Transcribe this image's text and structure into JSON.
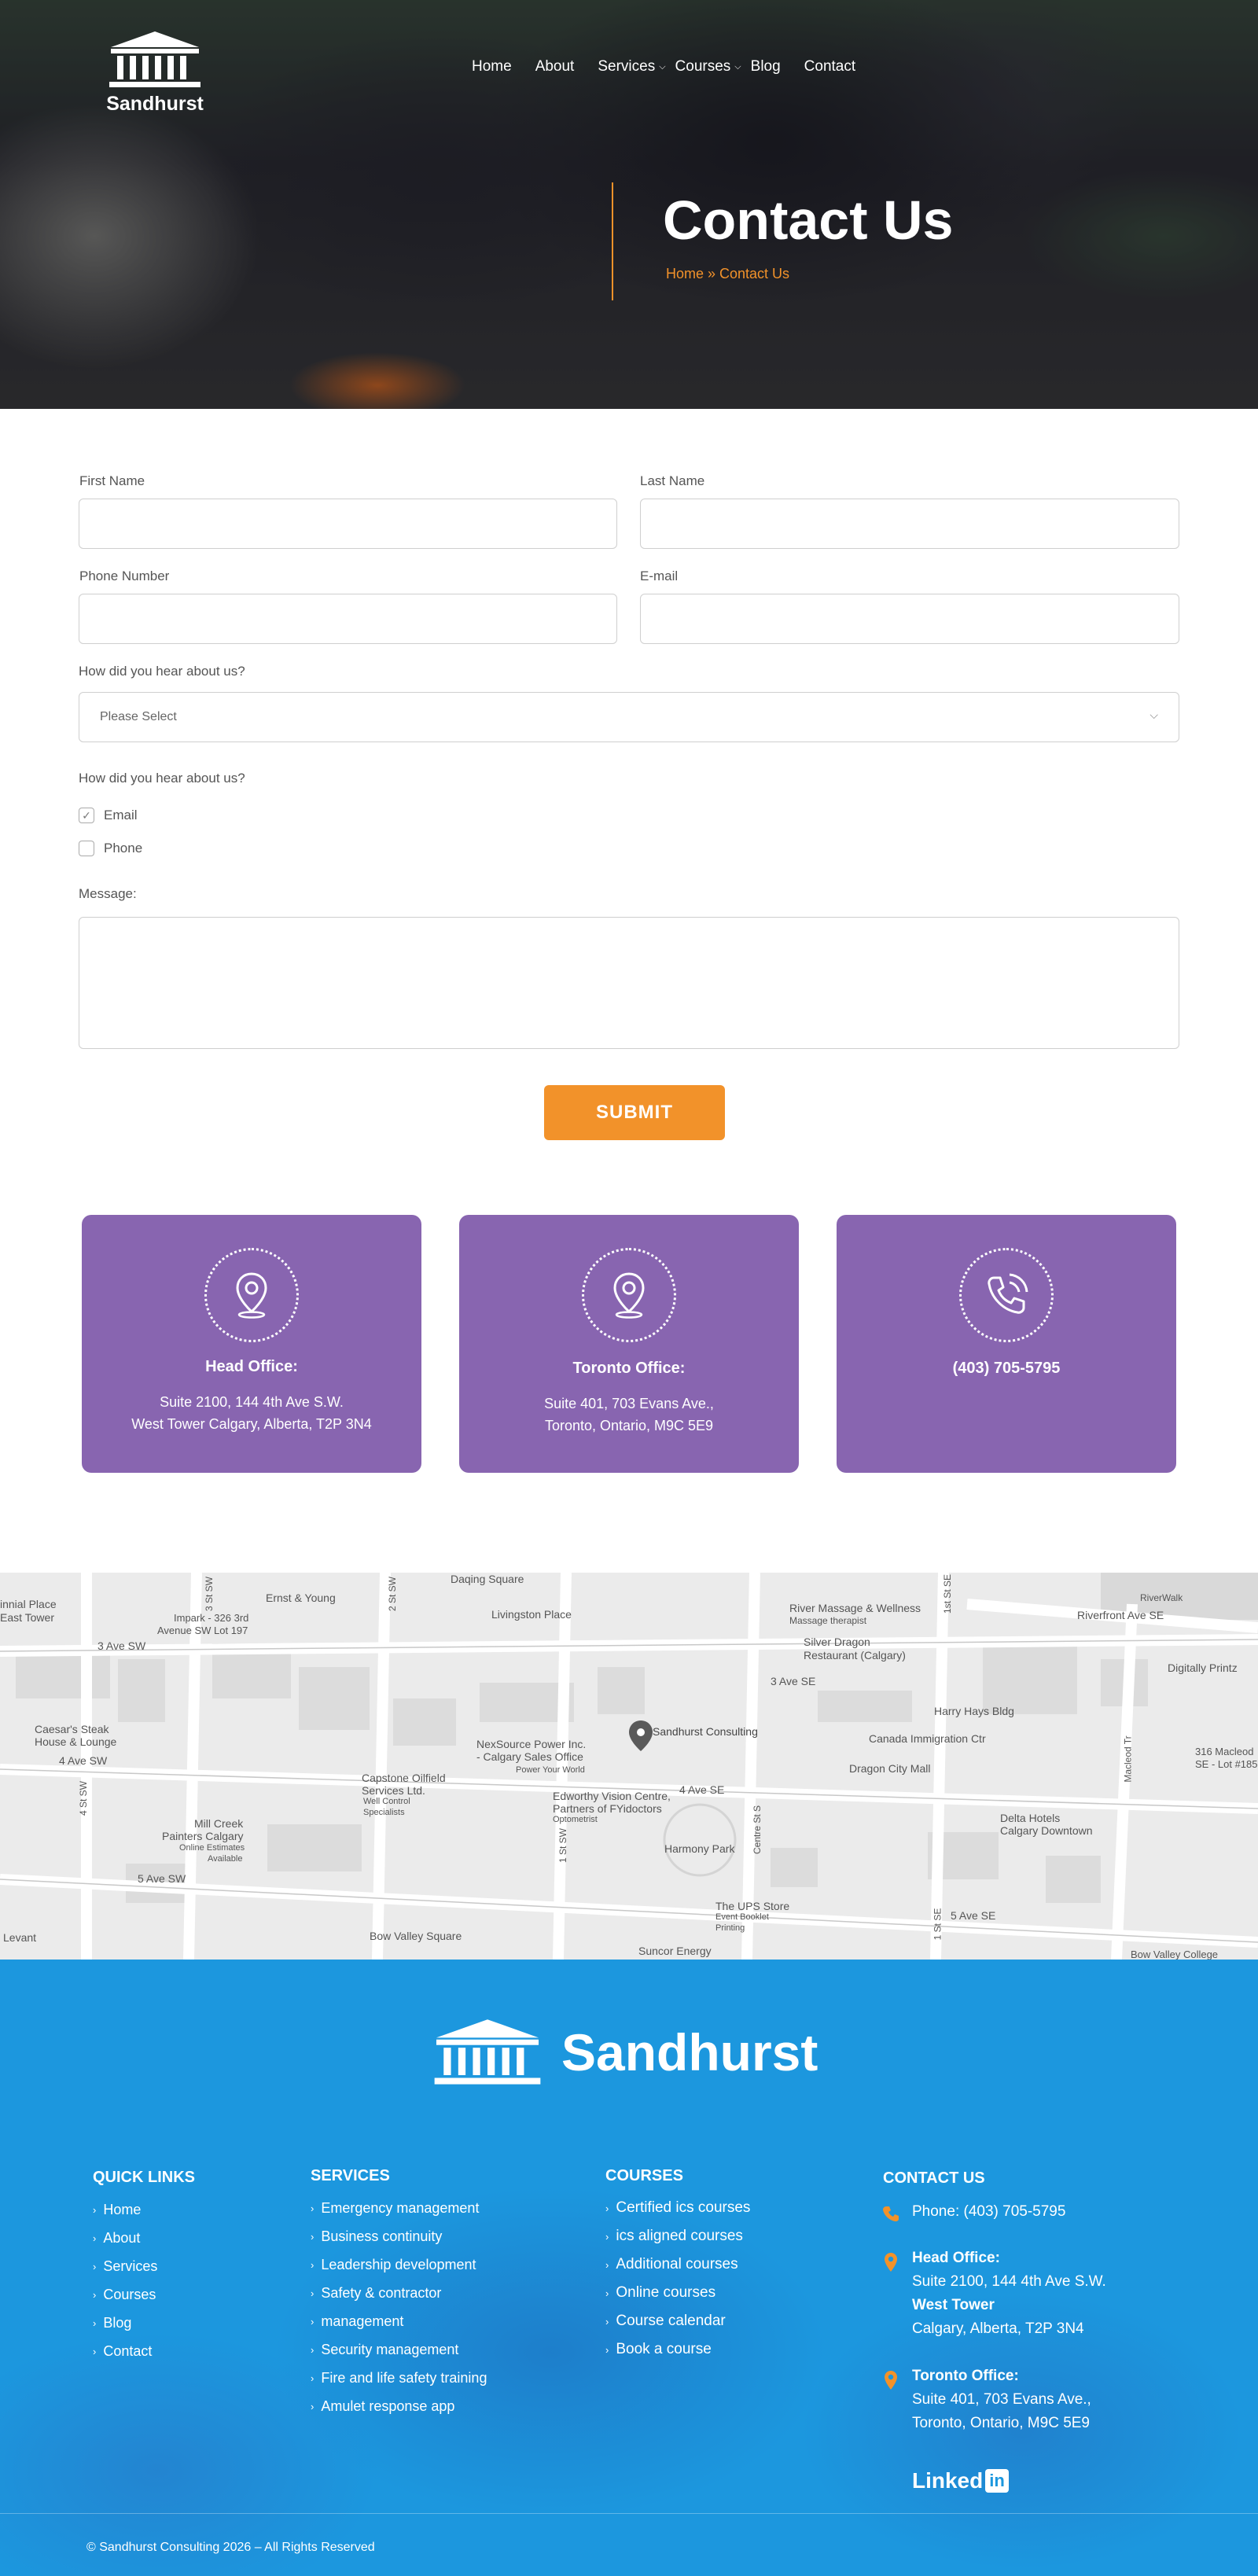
{
  "brand": {
    "name": "Sandhurst"
  },
  "nav": [
    {
      "label": "Home",
      "dropdown": false
    },
    {
      "label": "About",
      "dropdown": false
    },
    {
      "label": "Services",
      "dropdown": true
    },
    {
      "label": "Courses",
      "dropdown": true
    },
    {
      "label": "Blog",
      "dropdown": false
    },
    {
      "label": "Contact",
      "dropdown": false
    }
  ],
  "hero": {
    "title": "Contact Us",
    "breadcrumb": "Home » Contact Us"
  },
  "form": {
    "first_name_label": "First Name",
    "first_name_value": "",
    "last_name_label": "Last Name",
    "last_name_value": "",
    "phone_label": "Phone Number",
    "phone_value": "",
    "email_label": "E-mail",
    "email_value": "",
    "hear_label": "How did you hear about us?",
    "hear_selected": "Please Select",
    "contact_label": "How did you hear about us?",
    "options": [
      {
        "label": "Email",
        "checked": true
      },
      {
        "label": "Phone",
        "checked": false
      }
    ],
    "message_label": "Message:",
    "message_value": "",
    "submit_label": "SUBMIT"
  },
  "cards": [
    {
      "icon": "map-pin-icon",
      "title": "Head Office:",
      "lines": [
        "Suite 2100, 144 4th Ave S.W.",
        "West Tower Calgary, Alberta, T2P 3N4"
      ]
    },
    {
      "icon": "map-pin-icon",
      "title": "Toronto Office:",
      "lines": [
        "Suite 401, 703 Evans Ave.,",
        "Toronto, Ontario, M9C 5E9"
      ]
    },
    {
      "icon": "phone-icon",
      "title": "(403) 705-5795",
      "lines": []
    }
  ],
  "map": {
    "labels": [
      "Daqing Square",
      "Ernst & Young",
      "Livingston Place",
      "River Massage & Wellness",
      "Massage therapist",
      "Riverfront Ave SE",
      "RiverWalk",
      "Impark - 326 3rd",
      "Avenue SW Lot 197",
      "innial Place",
      "East Tower",
      "Silver Dragon",
      "Restaurant (Calgary)",
      "Digitally Printz",
      "3 Ave SW",
      "3 Ave SE",
      "Harry Hays Bldg",
      "Caesar's Steak",
      "House & Lounge",
      "Sandhurst Consulting",
      "Canada Immigration Ctr",
      "NexSource Power Inc.",
      "- Calgary Sales Office",
      "Power Your World",
      "Dragon City Mall",
      "316 Macleod",
      "SE - Lot #185",
      "4 Ave SW",
      "4 Ave SE",
      "Capstone Oilfield",
      "Services Ltd.",
      "Well Control",
      "Specialists",
      "Edworthy Vision Centre,",
      "Partners of FYidoctors",
      "Optometrist",
      "Delta Hotels",
      "Calgary Downtown",
      "Mill Creek",
      "Painters Calgary",
      "Online Estimates",
      "Available",
      "Harmony Park",
      "5 Ave SW",
      "5 Ave SE",
      "The UPS Store",
      "Event Booklet",
      "Printing",
      "Bow Valley Square",
      "Suncor Energy",
      "Bow Valley College",
      "Levant",
      "3 St SW",
      "2 St SW",
      "1 St SW",
      "Centre St S",
      "1 St SE",
      "1st St SE",
      "4 St SW",
      "Macleod Tr"
    ]
  },
  "footer": {
    "quick_links_heading": "QUICK LINKS",
    "quick_links": [
      "Home",
      "About",
      "Services",
      "Courses",
      "Blog",
      "Contact"
    ],
    "services_heading": "SERVICES",
    "services": [
      "Emergency management",
      "Business continuity",
      "Leadership development",
      "Safety & contractor",
      "management",
      "Security management",
      "Fire and life safety training",
      "Amulet response app"
    ],
    "courses_heading": "COURSES",
    "courses": [
      "Certified ics courses",
      "ics aligned courses",
      "Additional courses",
      "Online courses",
      "Course calendar",
      "Book a course"
    ],
    "contact_heading": "CONTACT US",
    "phone": "Phone: (403) 705-5795",
    "head_office_title": "Head Office:",
    "head_office_line1": "Suite 2100, 144 4th Ave S.W.",
    "head_office_line2": "West Tower",
    "head_office_line3": "Calgary, Alberta, T2P 3N4",
    "toronto_title": "Toronto Office:",
    "toronto_line1": "Suite 401, 703 Evans Ave.,",
    "toronto_line2": "Toronto, Ontario, M9C 5E9",
    "linkedin_text": "Linked",
    "linkedin_badge": "in",
    "copyright": "© Sandhurst Consulting 2026 – All Rights Reserved"
  },
  "colors": {
    "accent": "#f2922a",
    "card": "#8865b0",
    "footer": "#1c97de"
  }
}
